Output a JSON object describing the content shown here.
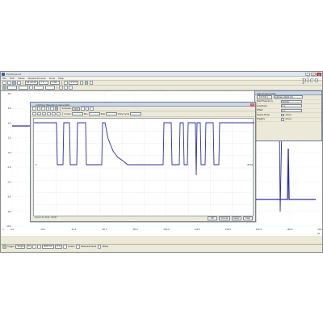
{
  "window": {
    "title": "PicoScope 6"
  },
  "menubar": [
    "File",
    "Edit",
    "Views",
    "Measurements",
    "Tools",
    "Help"
  ],
  "toolbar": {
    "timebase": "20 µs/div",
    "zoom": "x 1",
    "samples": "1 MS",
    "page": "1 of 1"
  },
  "logo": "pico",
  "scope": {
    "y_ticks": [
      "8.0",
      "6.0",
      "4.0",
      "2.0",
      "0.0",
      "-2.0",
      "-4.0",
      "-6.0",
      "-8.0",
      "-10.0"
    ],
    "x_ticks": [
      "0.0",
      "20.0",
      "40.0",
      "60.0",
      "80.0",
      "100.0",
      "120.0",
      "140.0",
      "160.0",
      "180.0",
      "200.0"
    ],
    "y_unit": "V",
    "x_unit": "µs",
    "trace_color": "#2a2fa8"
  },
  "awg": {
    "title": "Arbitrary Waveform Generator",
    "samples_label": "Samples:",
    "samples_value": "8192",
    "mode_labels": [
      "Cursor",
      "Min",
      "Max",
      "Duty Cycle"
    ],
    "y_axis_labels": [
      "0",
      "8192"
    ],
    "cursor_text": "Cursor at: 4141, 32767",
    "buttons": [
      "OK",
      "Cancel",
      "Apply",
      "Help"
    ]
  },
  "signal_generator": {
    "title": "Signal Generator",
    "waveform_button": "Arbitrary...",
    "waveform_value": "Arbitrary (8192 pt)",
    "rows": [
      {
        "k": "Start Frequency",
        "v": "50 kHz"
      },
      {
        "k": "Amplitude",
        "v": "2 V"
      },
      {
        "k": "Offset",
        "v": "0 V"
      }
    ],
    "sweep_label": "Sweep Mode",
    "sweep_state": "Active",
    "triggers_label": "Triggers",
    "triggers_state": "Active"
  },
  "statusbar": {
    "trigger_label": "Trigger",
    "trigger_mode": "Single",
    "channel": "A",
    "level": "800 mV",
    "pretrigger": "0 %",
    "rulers_label": "Rulers",
    "measurements_label": "Measurements",
    "notes_label": "Notes"
  }
}
